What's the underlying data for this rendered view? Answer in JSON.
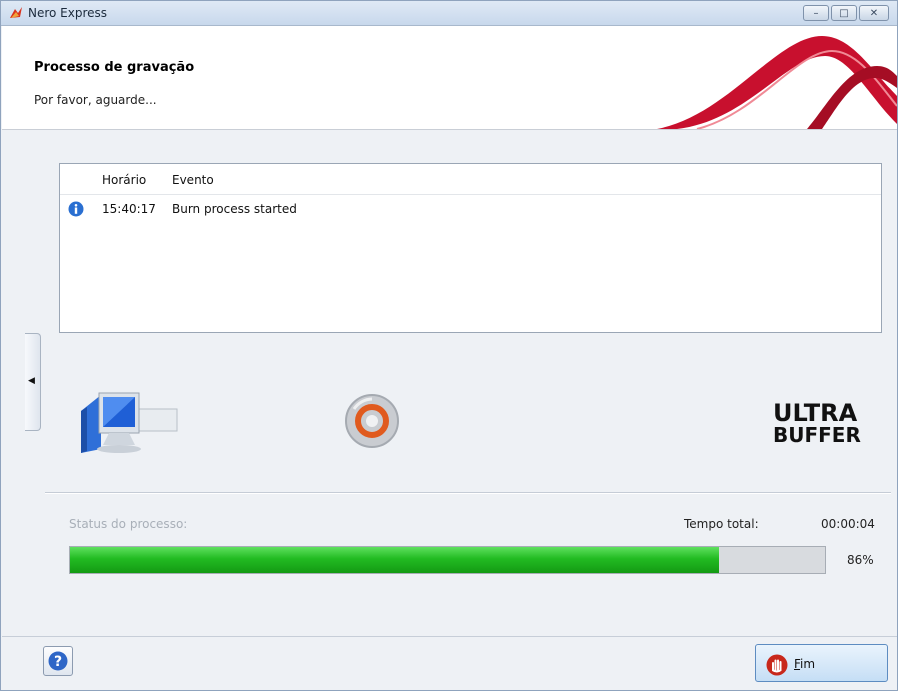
{
  "window": {
    "title": "Nero Express"
  },
  "header": {
    "title": "Processo de gravação",
    "subtitle": "Por favor, aguarde..."
  },
  "log": {
    "columns": [
      "Horário",
      "Evento"
    ],
    "rows": [
      {
        "icon": "info-icon",
        "time": "15:40:17",
        "event": "Burn process started"
      }
    ]
  },
  "status": {
    "label": "Status do processo:",
    "total_time_label": "Tempo total:",
    "total_time_value": "00:00:04",
    "progress_percent": 86,
    "percent_text": "86%"
  },
  "logo": {
    "line1": "ULTRA",
    "line2": "BUFFER"
  },
  "footer": {
    "end_button_first": "F",
    "end_button_rest": "im"
  },
  "colors": {
    "progress": "#22bb22",
    "accent_wave": "#d0202e"
  }
}
